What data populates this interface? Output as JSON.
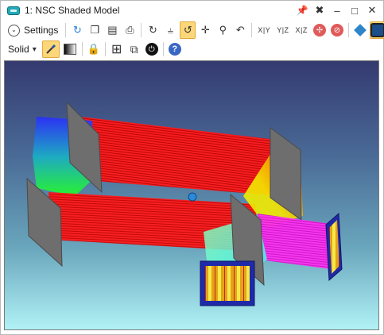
{
  "window": {
    "title": "1: NSC Shaded Model",
    "controls": {
      "pin": "📌",
      "close_x": "✖",
      "minimize": "–",
      "maximize": "□",
      "close": "✕"
    }
  },
  "toolbar1": {
    "settings_label": "Settings",
    "settings_glyph": "⌄",
    "refresh_glyph": "↻",
    "copy_glyph": "❐",
    "save_glyph": "▤",
    "print_glyph": "⎙",
    "rotate_glyph": "↻",
    "axes_glyph": "⫨",
    "reset_glyph": "↺",
    "pan_glyph": "✛",
    "zoom_glyph": "⚲",
    "undo_glyph": "↶",
    "axis_xy": "X|Y",
    "axis_yz": "Y|Z",
    "axis_xz": "X|Z"
  },
  "toolbar2": {
    "mode_label": "Solid",
    "mode_glyph": "▾",
    "lock_glyph": "🔒",
    "grid_glyph": "⊞",
    "window_glyph": "⧉",
    "power_glyph": "⏻",
    "help_glyph": "?"
  },
  "colors": {
    "background_top": "#343a6f",
    "background_bottom": "#b1f2f6",
    "ray_red": "#ff0000",
    "ray_blue": "#2a2cff",
    "ray_green": "#22ff22",
    "ray_yellow": "#f5e800",
    "ray_cyan": "#3ff2f2",
    "ray_magenta": "#ff2bf0",
    "detector_blue": "#1f2aa8",
    "detector_fill": "#f0d040",
    "mirror_gray": "#6e6e6e"
  }
}
